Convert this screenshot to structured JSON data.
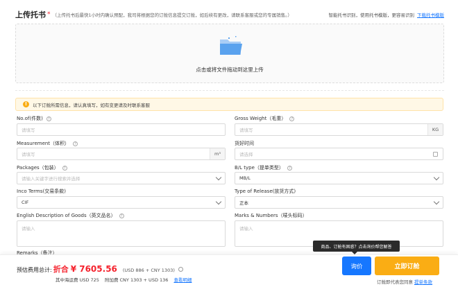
{
  "upload": {
    "title": "上传托书",
    "required_mark": "*",
    "note": "（上传托书后最快1小时内确认预配，我司将根据您的订舱信息提交订舱，如后续有更改，请联系客服或您的专属销售。）",
    "smart_text": "智能托书识别，使用托书模版，更容易识别",
    "download_link": "下载托书模版",
    "drop_text": "点击或将文件拖动到这里上传"
  },
  "notice": {
    "text": "以下订舱所需信息，请认真填写，如有变更请及时联系客服"
  },
  "form": {
    "pieces": {
      "label": "No.of(件数)",
      "placeholder": "请填写"
    },
    "gross_weight": {
      "label": "Gross Weight（毛重）",
      "placeholder": "请填写",
      "unit": "KG"
    },
    "measurement": {
      "label": "Measurement（体积）",
      "placeholder": "请填写",
      "unit": "m³"
    },
    "cargo_time": {
      "label": "货好时间",
      "placeholder": "请选择"
    },
    "packages": {
      "label": "Packages（包装）",
      "placeholder": "请输入关键字进行搜索并选择"
    },
    "bl_type": {
      "label": "B/L type（提单类型）",
      "value": "MB/L"
    },
    "incoterms": {
      "label": "Inco Terms(交易条款)",
      "value": "CIF"
    },
    "release_type": {
      "label": "Type of Release(放货方式)",
      "value": "正本"
    },
    "description": {
      "label": "English Description of Goods（英文品名）",
      "placeholder": "请输入"
    },
    "marks": {
      "label": "Marks & Numbers（唛头标码）",
      "placeholder": "请输入"
    },
    "remarks": {
      "label": "Remarks（备注）"
    }
  },
  "footer": {
    "total_label": "预估费用总计:",
    "total_prefix": "折合",
    "total_value": "¥ 7605.56",
    "total_sub": "(USD 886 + CNY 1303)",
    "ocean_fee": "其中海运费 USD 725",
    "surcharge": "附加费 CNY 1303 + USD 136",
    "detail_link": "查看明细",
    "tooltip": "商品、订舱有困惑？点击询价帮您解答",
    "inquiry_button": "询价",
    "book_button": "立即订舱",
    "agree_text": "订舱即代表您同意",
    "terms_link": "提单条款"
  },
  "colors": {
    "primary": "#1677ff",
    "accent": "#faad14",
    "price": "#f5222d"
  }
}
